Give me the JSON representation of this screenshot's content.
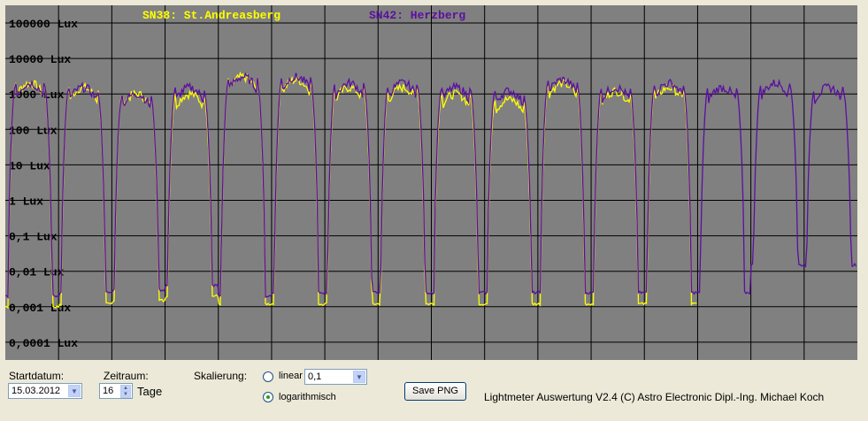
{
  "chart_data": {
    "type": "line",
    "y_scale": "log",
    "y_tick_labels": [
      "100000 Lux",
      "10000 Lux",
      "1000 Lux",
      "100 Lux",
      "10 Lux",
      "1 Lux",
      "0,1 Lux",
      "0,01 Lux",
      "0,001 Lux",
      "0,0001 Lux"
    ],
    "y_tick_values": [
      100000,
      10000,
      1000,
      100,
      10,
      1,
      0.1,
      0.01,
      0.001,
      0.0001
    ],
    "days": 16,
    "start_date": "15.03.2012",
    "grid": true,
    "legend_position": "top",
    "background_color": "#808080",
    "series": [
      {
        "name": "SN38: St.Andreasberg",
        "color": "#ffff00",
        "night_lux": [
          0.001,
          0.0012,
          0.0015,
          0.002,
          0.0012,
          0.0012,
          0.0012,
          0.0012,
          0.0012,
          0.0012,
          0.0012,
          0.0012,
          0.0012
        ],
        "day_peak_lux": [
          2000,
          1500,
          1000,
          1000,
          3000,
          2500,
          1500,
          1500,
          1000,
          700,
          2000,
          1200,
          1500
        ]
      },
      {
        "name": "SN42: Herzberg",
        "color": "#5b0fa0",
        "night_lux": [
          0.002,
          0.0025,
          0.003,
          0.004,
          0.002,
          0.0025,
          0.0025,
          0.0025,
          0.0025,
          0.0025,
          0.0025,
          0.0025,
          0.0025,
          0.0025,
          0.015,
          0.015
        ],
        "day_peak_lux": [
          2000,
          1500,
          1000,
          1500,
          3000,
          3000,
          2000,
          2000,
          1500,
          1200,
          2500,
          1500,
          2000,
          1500,
          2000,
          1500
        ]
      }
    ]
  },
  "controls": {
    "startdatum_label": "Startdatum:",
    "startdatum_value": "15.03.2012",
    "zeitraum_label": "Zeitraum:",
    "zeitraum_value": "16",
    "tage_label": "Tage",
    "skalierung_label": "Skalierung:",
    "linear_label": "linear",
    "linear_value": "0,1",
    "log_label": "logarithmisch",
    "selected_scale": "logarithmisch",
    "save_button": "Save PNG",
    "footer_text": "Lightmeter Auswertung V2.4  (C) Astro Electronic Dipl.-Ing. Michael Koch"
  }
}
